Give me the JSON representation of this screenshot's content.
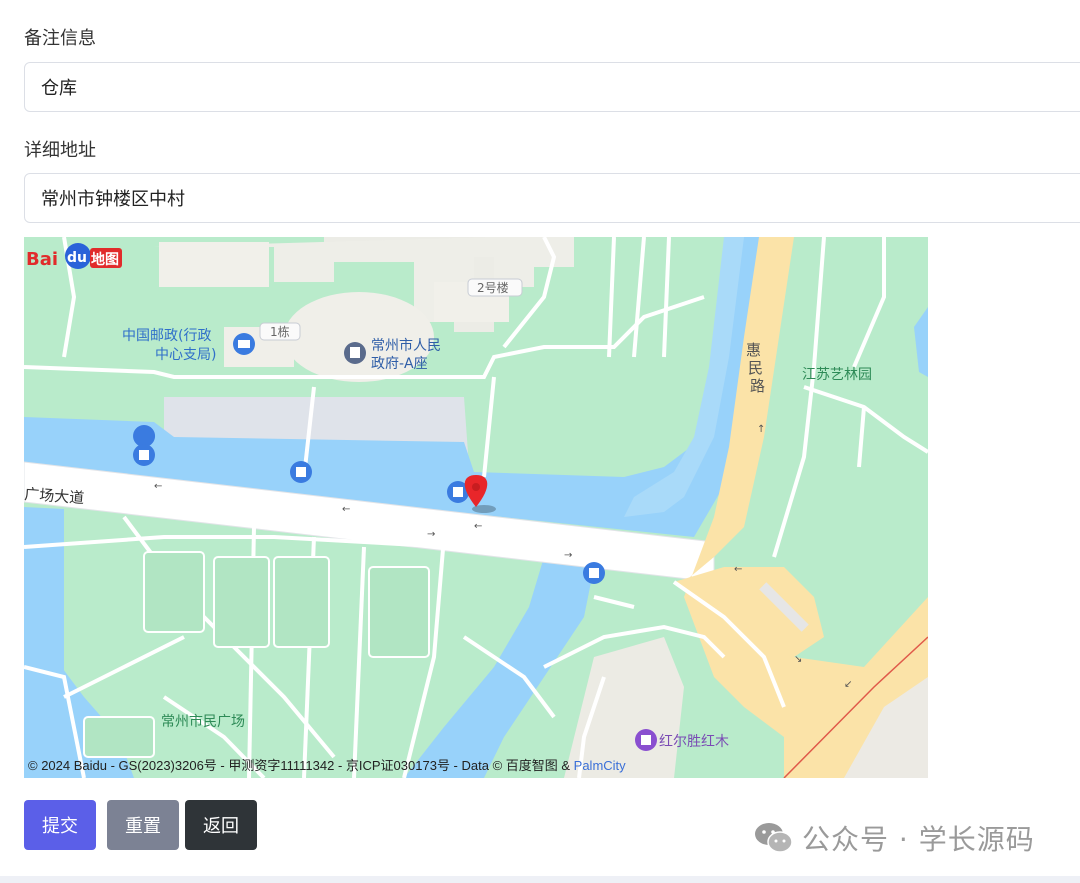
{
  "form": {
    "remark_label": "备注信息",
    "remark_value": "仓库",
    "address_label": "详细地址",
    "address_value": "常州市钟楼区中村"
  },
  "map": {
    "pois": {
      "post_office_line1": "中国邮政(行政",
      "post_office_line2": "中心支局)",
      "building_1": "1栋",
      "building_2": "2号楼",
      "government_line1": "常州市人民",
      "government_line2": "政府-A座",
      "jiangsu_garden": "江苏艺林园",
      "huimin_road": "惠民路",
      "square_avenue": "广场大道",
      "citizen_square": "常州市民广场",
      "hongershen": "红尔胜红木"
    },
    "logo_text": "Bai",
    "logo_text2": "du",
    "logo_text3": "地图",
    "copyright_main": "© 2024 Baidu - GS(2023)3206号 - 甲测资字11111342 - 京ICP证030173号 - Data © 百度智图 & ",
    "copyright_link": "PalmCity"
  },
  "buttons": {
    "submit": "提交",
    "reset": "重置",
    "back": "返回"
  },
  "watermark": {
    "text": "公众号 · 学长源码"
  },
  "colors": {
    "submit": "#5b5fe8",
    "reset": "#7c8294",
    "back": "#2f3438",
    "map_green": "#b9ebcb",
    "map_water": "#98d2fa",
    "map_road_major": "#fbe3a8",
    "marker": "#e8262a"
  }
}
